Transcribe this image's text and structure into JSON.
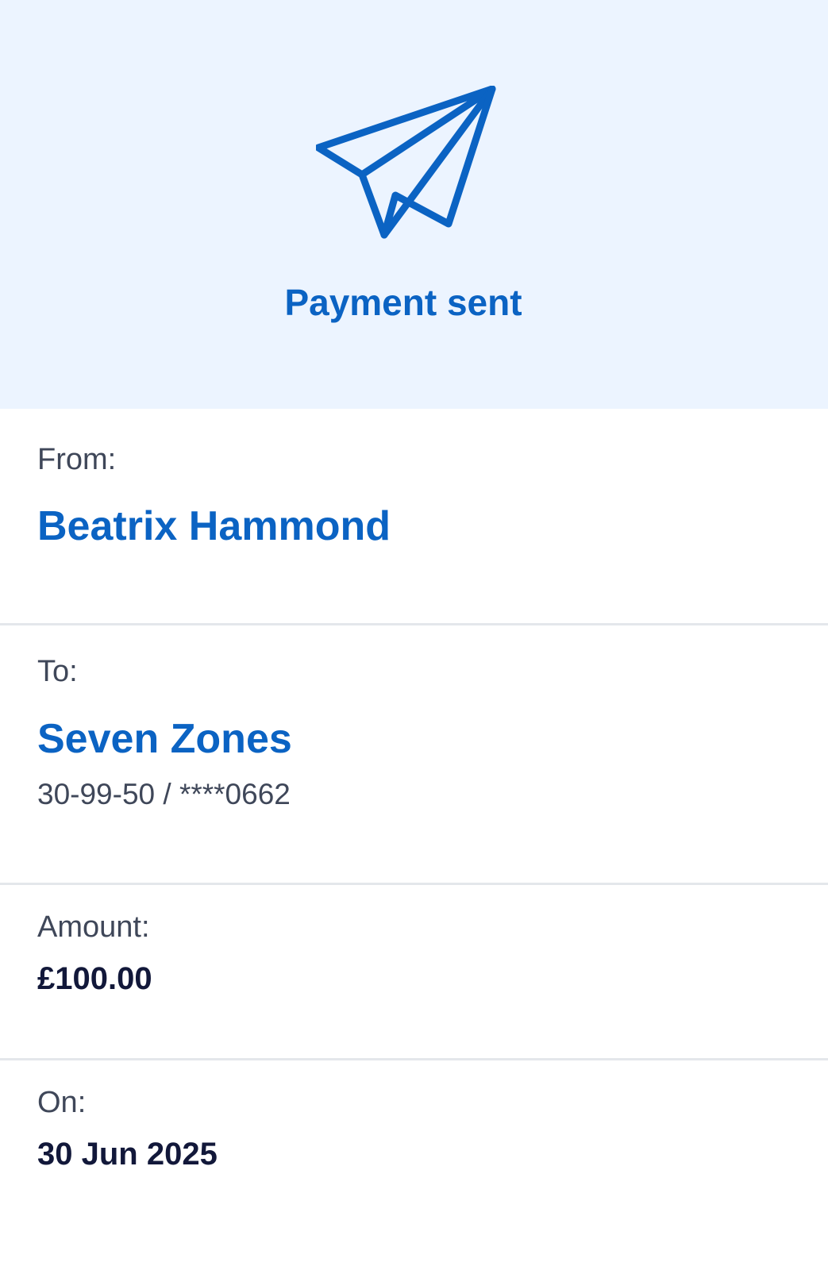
{
  "header": {
    "title": "Payment sent",
    "icon": "paper-plane-icon"
  },
  "from": {
    "label": "From:",
    "name": "Beatrix Hammond"
  },
  "to": {
    "label": "To:",
    "name": "Seven Zones",
    "account": "30-99-50 / ****0662"
  },
  "amount": {
    "label": "Amount:",
    "value": "£100.00"
  },
  "date": {
    "label": "On:",
    "value": "30 Jun 2025"
  },
  "colors": {
    "accent": "#0b63c3",
    "hero_background": "#ecf4ff",
    "divider": "#e4e7eb"
  }
}
